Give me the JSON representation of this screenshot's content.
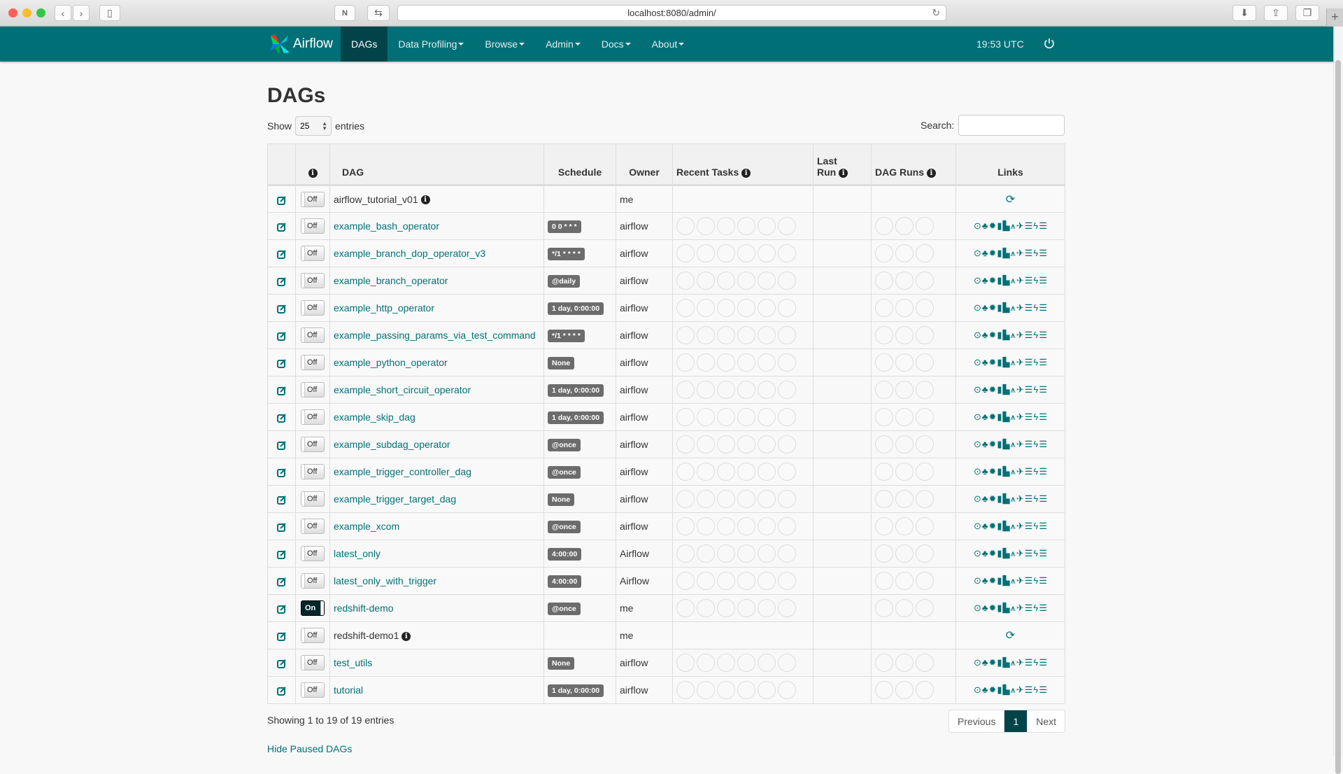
{
  "browser": {
    "url": "localhost:8080/admin/"
  },
  "navbar": {
    "brand": "Airflow",
    "items": [
      {
        "label": "DAGs",
        "active": true,
        "dropdown": false
      },
      {
        "label": "Data Profiling",
        "active": false,
        "dropdown": true
      },
      {
        "label": "Browse",
        "active": false,
        "dropdown": true
      },
      {
        "label": "Admin",
        "active": false,
        "dropdown": true
      },
      {
        "label": "Docs",
        "active": false,
        "dropdown": true
      },
      {
        "label": "About",
        "active": false,
        "dropdown": true
      }
    ],
    "clock": "19:53 UTC"
  },
  "page": {
    "title": "DAGs",
    "show_label": "Show",
    "entries_value": "25",
    "entries_label": "entries",
    "search_label": "Search:",
    "search_value": "",
    "info_text": "Showing 1 to 19 of 19 entries",
    "hide_paused": "Hide Paused DAGs",
    "pager": {
      "previous": "Previous",
      "current": "1",
      "next": "Next"
    }
  },
  "table": {
    "headers": {
      "info": "ℹ",
      "dag": "DAG",
      "schedule": "Schedule",
      "owner": "Owner",
      "recent_tasks": "Recent Tasks",
      "last_run_1": "Last",
      "last_run_2": "Run",
      "dag_runs": "DAG Runs",
      "links": "Links"
    },
    "rows": [
      {
        "dag": "airflow_tutorial_v01",
        "toggle": "Off",
        "schedule": "",
        "owner": "me",
        "active_link": false,
        "missing": true
      },
      {
        "dag": "example_bash_operator",
        "toggle": "Off",
        "schedule": "0 0 * * *",
        "owner": "airflow",
        "active_link": true,
        "missing": false
      },
      {
        "dag": "example_branch_dop_operator_v3",
        "toggle": "Off",
        "schedule": "*/1 * * * *",
        "owner": "airflow",
        "active_link": true,
        "missing": false
      },
      {
        "dag": "example_branch_operator",
        "toggle": "Off",
        "schedule": "@daily",
        "owner": "airflow",
        "active_link": true,
        "missing": false
      },
      {
        "dag": "example_http_operator",
        "toggle": "Off",
        "schedule": "1 day, 0:00:00",
        "owner": "airflow",
        "active_link": true,
        "missing": false
      },
      {
        "dag": "example_passing_params_via_test_command",
        "toggle": "Off",
        "schedule": "*/1 * * * *",
        "owner": "airflow",
        "active_link": true,
        "missing": false
      },
      {
        "dag": "example_python_operator",
        "toggle": "Off",
        "schedule": "None",
        "owner": "airflow",
        "active_link": true,
        "missing": false
      },
      {
        "dag": "example_short_circuit_operator",
        "toggle": "Off",
        "schedule": "1 day, 0:00:00",
        "owner": "airflow",
        "active_link": true,
        "missing": false
      },
      {
        "dag": "example_skip_dag",
        "toggle": "Off",
        "schedule": "1 day, 0:00:00",
        "owner": "airflow",
        "active_link": true,
        "missing": false
      },
      {
        "dag": "example_subdag_operator",
        "toggle": "Off",
        "schedule": "@once",
        "owner": "airflow",
        "active_link": true,
        "missing": false
      },
      {
        "dag": "example_trigger_controller_dag",
        "toggle": "Off",
        "schedule": "@once",
        "owner": "airflow",
        "active_link": true,
        "missing": false
      },
      {
        "dag": "example_trigger_target_dag",
        "toggle": "Off",
        "schedule": "None",
        "owner": "airflow",
        "active_link": true,
        "missing": false
      },
      {
        "dag": "example_xcom",
        "toggle": "Off",
        "schedule": "@once",
        "owner": "airflow",
        "active_link": true,
        "missing": false
      },
      {
        "dag": "latest_only",
        "toggle": "Off",
        "schedule": "4:00:00",
        "owner": "Airflow",
        "active_link": true,
        "missing": false
      },
      {
        "dag": "latest_only_with_trigger",
        "toggle": "Off",
        "schedule": "4:00:00",
        "owner": "Airflow",
        "active_link": true,
        "missing": false
      },
      {
        "dag": "redshift-demo",
        "toggle": "On",
        "schedule": "@once",
        "owner": "me",
        "active_link": true,
        "missing": false
      },
      {
        "dag": "redshift-demo1",
        "toggle": "Off",
        "schedule": "",
        "owner": "me",
        "active_link": false,
        "missing": true
      },
      {
        "dag": "test_utils",
        "toggle": "Off",
        "schedule": "None",
        "owner": "airflow",
        "active_link": true,
        "missing": false
      },
      {
        "dag": "tutorial",
        "toggle": "Off",
        "schedule": "1 day, 0:00:00",
        "owner": "airflow",
        "active_link": true,
        "missing": false
      }
    ],
    "link_icons": [
      "trigger-dag-icon",
      "tree-view-icon",
      "graph-view-icon",
      "task-duration-icon",
      "task-tries-icon",
      "landing-times-icon",
      "gantt-icon",
      "code-icon",
      "logs-icon",
      "refresh-icon"
    ]
  },
  "colors": {
    "brand": "#017076",
    "brand_dark": "#024349",
    "badge": "#6c6c6c"
  }
}
